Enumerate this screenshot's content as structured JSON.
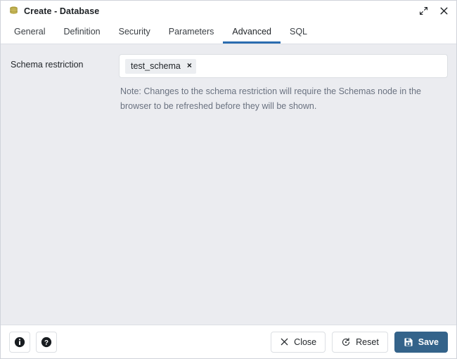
{
  "window": {
    "title": "Create - Database",
    "icon": "database-icon",
    "controls": [
      {
        "name": "maximize-icon",
        "label": "Maximize"
      },
      {
        "name": "close-icon",
        "label": "Close"
      }
    ]
  },
  "tabs": [
    {
      "label": "General",
      "active": false
    },
    {
      "label": "Definition",
      "active": false
    },
    {
      "label": "Security",
      "active": false
    },
    {
      "label": "Parameters",
      "active": false
    },
    {
      "label": "Advanced",
      "active": true
    },
    {
      "label": "SQL",
      "active": false
    }
  ],
  "form": {
    "schema_restriction": {
      "label": "Schema restriction",
      "chips": [
        {
          "label": "test_schema",
          "remove": "×"
        }
      ],
      "placeholder": "",
      "note": "Note: Changes to the schema restriction will require the Schemas node in the browser to be refreshed before they will be shown."
    }
  },
  "footer": {
    "info_button": {
      "name": "info-icon",
      "label": "Info"
    },
    "help_button": {
      "name": "help-icon",
      "label": "Help"
    },
    "close_label": "Close",
    "reset_label": "Reset",
    "save_label": "Save"
  },
  "colors": {
    "accent": "#2b6cb0",
    "primary_button": "#34638a",
    "body_background": "#ebecf0",
    "database_icon": "#9c8e3a",
    "note_text": "#6a7280"
  }
}
